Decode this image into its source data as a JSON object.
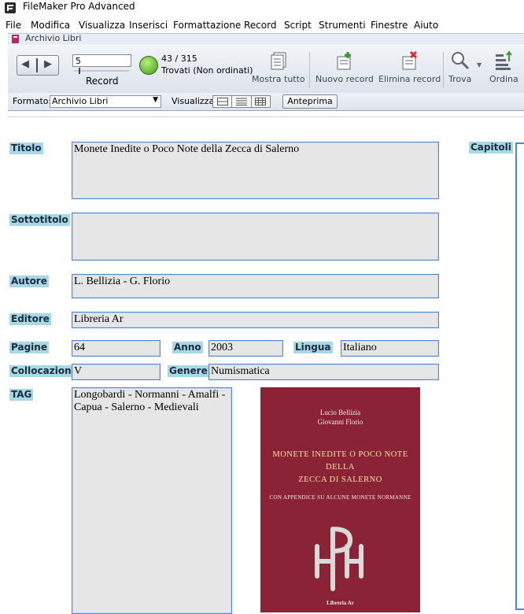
{
  "app": {
    "title": "FileMaker Pro Advanced"
  },
  "menu": [
    "File",
    "Modifica",
    "Visualizza",
    "Inserisci",
    "Formattazione",
    "Record",
    "Script",
    "Strumenti",
    "Finestre",
    "Aiuto"
  ],
  "window": {
    "title": "Archivio Libri"
  },
  "toolbar": {
    "record_value": "5",
    "record_label": "Record",
    "found_count": "43 / 315",
    "found_status": "Trovati (Non ordinati)",
    "show_all": "Mostra tutto",
    "new_record": "Nuovo record",
    "delete_record": "Elimina record",
    "find": "Trova",
    "sort": "Ordina"
  },
  "layoutbar": {
    "format_label": "Formato:",
    "format_value": "Archivio Libri",
    "view_label": "Visualizza:",
    "preview": "Anteprima"
  },
  "labels": {
    "titolo": "Titolo",
    "sottotitolo": "Sottotitolo",
    "autore": "Autore",
    "editore": "Editore",
    "pagine": "Pagine",
    "anno": "Anno",
    "lingua": "Lingua",
    "collocazione": "Collocazione",
    "genere": "Genere",
    "tag": "TAG",
    "capitoli": "Capitoli"
  },
  "record": {
    "titolo": "Monete Inedite o Poco Note della Zecca di Salerno",
    "sottotitolo": "",
    "autore": "L. Bellizia - G. Florio",
    "editore": "Libreria Ar",
    "pagine": "64",
    "anno": "2003",
    "lingua": "Italiano",
    "collocazione": "V",
    "genere": "Numismatica",
    "tag": "Longobardi - Normanni - Amalfi - Capua - Salerno - Medievali"
  },
  "cover": {
    "author1": "Lucio Bellizia",
    "author2": "Giovanni Florio",
    "title1": "MONETE INEDITE O POCO NOTE",
    "title2": "DELLA",
    "title3": "ZECCA DI SALERNO",
    "subtitle": "CON APPENDICE SU ALCUNE MONETE NORMANNE",
    "publisher": "Libreria Ar"
  },
  "colors": {
    "label_bg": "#a6d8e8",
    "field_border": "#4d86e0",
    "field_bg": "#e6e6e6",
    "cover_bg": "#8a2335"
  }
}
